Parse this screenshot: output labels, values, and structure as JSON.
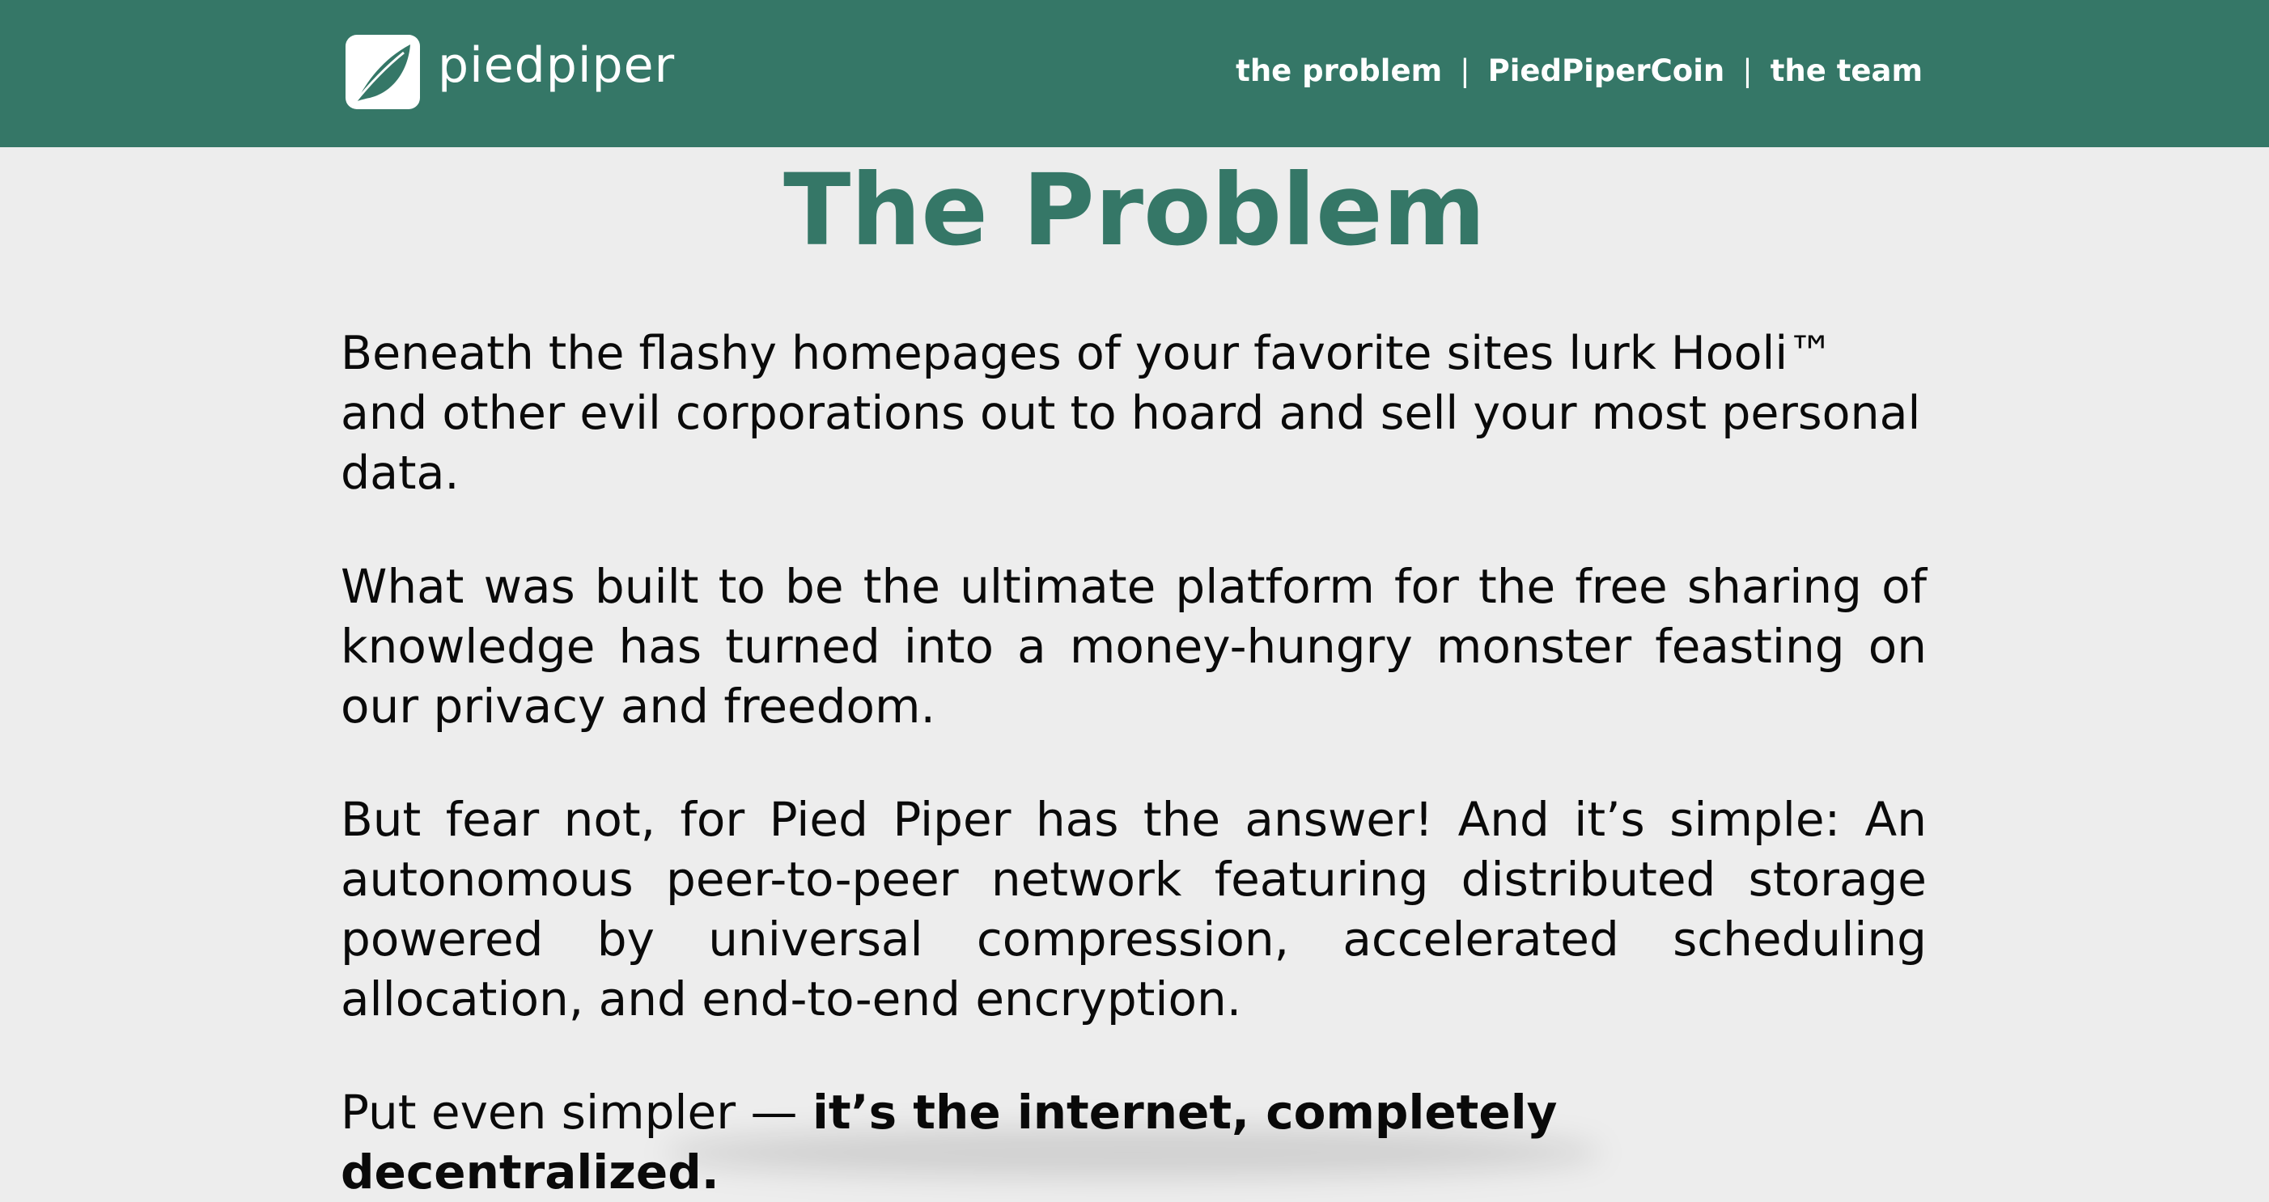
{
  "header": {
    "logo_text": "piedpiper",
    "logo_icon": "leaf-icon",
    "nav": [
      {
        "label": "the problem"
      },
      {
        "label": "PiedPiperCoin"
      },
      {
        "label": "the team"
      }
    ],
    "separator": "|"
  },
  "main": {
    "title": "The Problem",
    "paragraphs": [
      "Beneath the flashy homepages of your favorite sites lurk Hooli™ and other evil corporations out to hoard and sell your most personal data.",
      "What was built to be the ultimate platform for the free sharing of knowledge has turned into a money-hungry monster feasting on our privacy and freedom.",
      "But fear not, for Pied Piper has the answer! And it’s simple: An autonomous peer-to-peer network featuring distributed storage powered by universal compression, accelerated scheduling allocation, and end-to-end encryption."
    ],
    "closing": {
      "prefix": "Put even simpler — ",
      "emphasis": "it’s the internet, completely decentralized."
    }
  },
  "colors": {
    "brand": "#357767",
    "background": "#ededed",
    "text": "#0a0a0a",
    "header_text": "#ffffff"
  }
}
